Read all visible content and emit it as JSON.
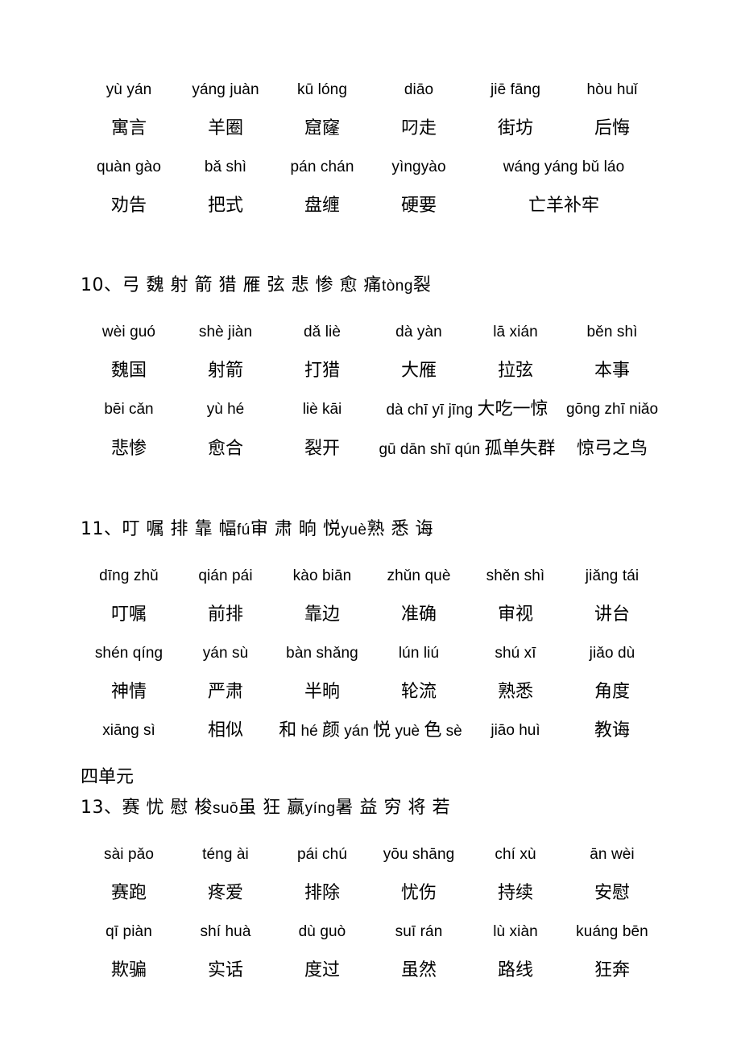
{
  "document": {
    "type": "chinese-vocabulary-worksheet",
    "unit_label": "四单元"
  },
  "section_09_tail": {
    "rows": [
      {
        "kind": "pinyin",
        "cells": [
          "yù yán",
          "yáng juàn",
          "kū lóng",
          "diāo",
          "jiē fāng",
          "hòu huǐ"
        ]
      },
      {
        "kind": "hanzi",
        "cells": [
          "寓言",
          "羊圈",
          "窟窿",
          "叼走",
          "街坊",
          "后悔"
        ]
      },
      {
        "kind": "pinyin",
        "cells": [
          "quàn gào",
          "bǎ shì",
          "pán chán",
          "yìngyào",
          "wáng yáng bǔ láo"
        ]
      },
      {
        "kind": "hanzi",
        "cells": [
          "劝告",
          "把式",
          "盘缠",
          "硬要",
          "亡羊补牢"
        ]
      }
    ]
  },
  "section_10": {
    "number": "10、",
    "chars": "弓 魏 射 箭 猎 雁 弦 悲 惨 愈 痛",
    "char_pinyin": "tòng",
    "chars_tail": "裂",
    "rows": [
      {
        "kind": "pinyin",
        "cells": [
          "wèi guó",
          "shè jiàn",
          "dǎ liè",
          "dà yàn",
          "lā xián",
          "běn shì"
        ]
      },
      {
        "kind": "hanzi",
        "cells": [
          "魏国",
          "射箭",
          "打猎",
          "大雁",
          "拉弦",
          "本事"
        ]
      },
      {
        "kind": "mixed",
        "cells": [
          {
            "py": "bēi cǎn",
            "hz": ""
          },
          {
            "py": "yù hé",
            "hz": ""
          },
          {
            "py": "liè kāi",
            "hz": ""
          },
          {
            "py": "dà chī yī jīng ",
            "hz": "大吃一惊"
          },
          {
            "py": "gōng zhī niǎo",
            "hz": ""
          }
        ]
      },
      {
        "kind": "mixed",
        "cells": [
          {
            "py": "",
            "hz": "悲惨"
          },
          {
            "py": "",
            "hz": "愈合"
          },
          {
            "py": "",
            "hz": "裂开"
          },
          {
            "py": "gū dān shī qún ",
            "hz": "孤单失群"
          },
          {
            "py": "",
            "hz": "惊弓之鸟"
          }
        ]
      }
    ]
  },
  "section_11": {
    "number": "11、",
    "chars_a": "叮 嘱 排 靠 幅",
    "py_a": "fú",
    "chars_b": "审 肃 晌 悦",
    "py_b": "yuè",
    "chars_c": "熟 悉 诲",
    "rows": [
      {
        "kind": "pinyin",
        "cells": [
          "dīng zhǔ",
          "qián pái",
          "kào biān",
          "zhǔn què",
          "shěn shì",
          "jiǎng tái"
        ]
      },
      {
        "kind": "hanzi",
        "cells": [
          "叮嘱",
          "前排",
          "靠边",
          "准确",
          "审视",
          "讲台"
        ]
      },
      {
        "kind": "pinyin",
        "cells": [
          "shén qíng",
          "yán sù",
          "bàn shǎng",
          "lún liú",
          "shú xī",
          "jiǎo dù"
        ]
      },
      {
        "kind": "hanzi",
        "cells": [
          "神情",
          "严肃",
          "半晌",
          "轮流",
          "熟悉",
          "角度"
        ]
      },
      {
        "kind": "interleaved",
        "cells": [
          {
            "py": "xiāng sì",
            "hz": ""
          },
          {
            "py": "",
            "hz": "相似"
          },
          {
            "parts": [
              {
                "hz": "和"
              },
              {
                "py": " hé "
              },
              {
                "hz": "颜"
              },
              {
                "py": " yán "
              },
              {
                "hz": "悦"
              },
              {
                "py": " yuè "
              },
              {
                "hz": "色"
              },
              {
                "py": " sè"
              }
            ]
          },
          {
            "py": "jiāo huì",
            "hz": ""
          },
          {
            "py": "",
            "hz": "教诲"
          }
        ]
      }
    ]
  },
  "section_13": {
    "number": "13、",
    "chars_a": "赛 忧 慰 梭",
    "py_a": "suō",
    "chars_b": "虽 狂 赢",
    "py_b": "yíng",
    "chars_c": "暑 益 穷  将 若",
    "rows": [
      {
        "kind": "pinyin",
        "cells": [
          "sài pǎo",
          "téng ài",
          "pái chú",
          "yōu shāng",
          "chí xù",
          "ān wèi"
        ]
      },
      {
        "kind": "hanzi",
        "cells": [
          "赛跑",
          "疼爱",
          "排除",
          "忧伤",
          "持续",
          "安慰"
        ]
      },
      {
        "kind": "pinyin",
        "cells": [
          "qī piàn",
          "shí huà",
          "dù guò",
          "suī rán",
          "lù xiàn",
          "kuáng bēn"
        ]
      },
      {
        "kind": "hanzi",
        "cells": [
          "欺骗",
          "实话",
          "度过",
          "虽然",
          "路线",
          "狂奔"
        ]
      }
    ]
  }
}
